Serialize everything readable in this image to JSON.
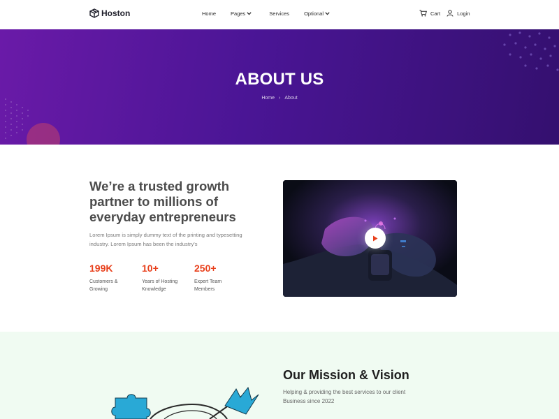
{
  "nav": {
    "logo_text": "Hoston",
    "menu": [
      {
        "label": "Home",
        "dropdown": false
      },
      {
        "label": "Pages",
        "dropdown": true
      },
      {
        "label": "Services",
        "dropdown": false
      },
      {
        "label": "Optional",
        "dropdown": true
      }
    ],
    "cart_label": "Cart",
    "login_label": "Login"
  },
  "hero": {
    "title": "ABOUT US",
    "breadcrumb": {
      "home": "Home",
      "separator": "›",
      "current": "About"
    }
  },
  "about": {
    "heading": "We’re a trusted growth partner to millions of everyday entrepreneurs",
    "description": "Lorem Ipsum is simply dummy text of the printing and typesetting industry. Lorem Ipsum has been the industry's",
    "stats": [
      {
        "value": "199K",
        "label": "Customers & Growing"
      },
      {
        "value": "10+",
        "label": "Years of Hosting Knowledge"
      },
      {
        "value": "250+",
        "label": "Expert Team Members"
      }
    ]
  },
  "mission": {
    "title": "Our Mission & Vision",
    "description": "Helping & providing the best services to our client Business since 2022"
  },
  "colors": {
    "hero_start": "#6a1aa8",
    "hero_end": "#34106f",
    "accent": "#e8401c",
    "mission_bg": "#f0fbf2",
    "puzzle": "#29a9d6"
  },
  "icons": {
    "logo": "box-icon",
    "dropdown": "chevron-down-icon",
    "cart": "cart-icon",
    "login": "user-icon",
    "play": "play-icon"
  }
}
